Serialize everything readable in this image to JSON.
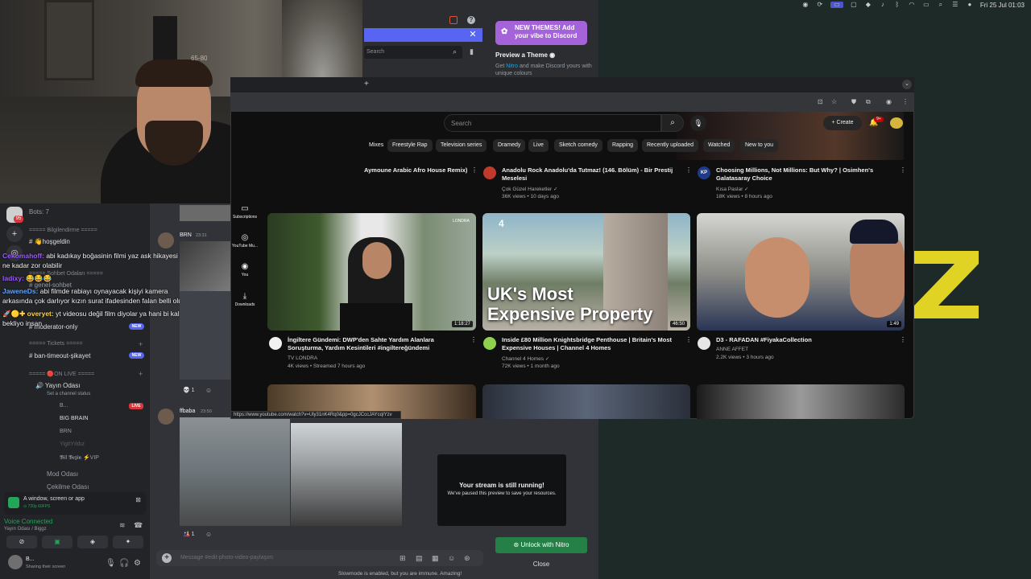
{
  "menubar": {
    "datetime": "Fri 25 Jul  01:03",
    "icons": [
      "control-icon",
      "refresh-icon",
      "screen-share-icon",
      "display-icon",
      "wifi-icon",
      "volume-icon",
      "bluetooth-icon",
      "battery-icon",
      "control-center-icon",
      "siri-icon"
    ]
  },
  "discord": {
    "popout": {
      "search_placeholder": "Search",
      "theme_badge": "NEW THEMES! Add your vibe to Discord",
      "preview_theme": "Preview a Theme",
      "nitro_prefix": "Get ",
      "nitro_link": "Nitro",
      "nitro_suffix": " and make Discord yours with unique colours"
    },
    "server": {
      "avatar_badge": "95",
      "bots": "Bots: 7",
      "channels": [
        {
          "label": "===== Bilgilendirme =====",
          "type": "category"
        },
        {
          "label": "#  👋hoşgeldin",
          "type": "text"
        },
        {
          "label": "===== Sohbet Odaları =====",
          "type": "category"
        },
        {
          "label": "#  genel-sohbet",
          "type": "text"
        },
        {
          "label": "#  moderator-only",
          "type": "text",
          "badge": "NEW"
        },
        {
          "label": "===== Tickets =====",
          "type": "category"
        },
        {
          "label": "#  ban-timeout-şikayet",
          "type": "text",
          "badge": "NEW"
        },
        {
          "label": "===== 🔴ON LIVE =====",
          "type": "category"
        },
        {
          "label": "Yayın Odası",
          "type": "voice",
          "sub": "Set a channel status"
        }
      ],
      "voice_users": [
        {
          "name": "B...",
          "live": "LIVE"
        },
        {
          "name": "BIG BRAIN"
        },
        {
          "name": "BRN"
        },
        {
          "name": "YigitYıldız"
        },
        {
          "name": "𝕭𝖎𝖑 𝕭𝖊𝖟𝖎𝖓 ⚡VIP"
        }
      ],
      "more_channels": [
        "Mod Odası",
        "Çekilme Odası"
      ]
    },
    "overlay_chat": [
      {
        "name": "Cekomahoff:",
        "text": " abi kadıkay boğasinin filmi yaz ask hikayesi değil",
        "color": "#9b59ff"
      },
      {
        "name": "",
        "text": "ne kadar zor olabilir",
        "color": "#ffffff"
      },
      {
        "name": "ladixy:",
        "text": " 😂😂😂",
        "color": "#9b59ff"
      },
      {
        "name": "JaweneDs:",
        "text": " abi filmde rabiayı oynayacak kişiyi kamera",
        "color": "#5fa4ff"
      },
      {
        "name": "",
        "text": "arkasında çok darlıyor kızın surat ifadesinden falan belli oluyor",
        "color": "#ffffff"
      },
      {
        "name": "🚀🟡✚ overyet:",
        "text": " yt videosu değil film diyolar ya hani bi kalite",
        "color": "#ffd24a"
      },
      {
        "name": "",
        "text": "bekliyo insan",
        "color": "#ffffff"
      }
    ],
    "voice_panel": {
      "title": "A window, screen or app",
      "sub": "⊙ 720p 60FPS",
      "status": "Voice Connected",
      "channel": "Yayın Odası / Biggz"
    },
    "user": {
      "name": "B...",
      "status": "Sharing their screen"
    },
    "chat": {
      "msg1_name": "BRN",
      "msg1_time": "23:31",
      "reaction1": "1",
      "msg2_name": "ffbaba",
      "msg2_time": "23:50",
      "reaction2": "1",
      "composer_placeholder": "Message #edit-photo-video-paylaşım",
      "slowmode": "Slowmode is enabled, but you are immune. Amazing!"
    },
    "stream_card": {
      "title": "Your stream is still running!",
      "sub": "We've paused this preview to save your resources."
    },
    "unlock_label": "Unlock with Nitro",
    "close_label": "Close"
  },
  "youtube": {
    "search_placeholder": "Search",
    "create_label": "Create",
    "notif_count": "9+",
    "chips": [
      "Mixes",
      "Freestyle Rap",
      "Television series",
      "Dramedy",
      "Live",
      "Sketch comedy",
      "Rapping",
      "Recently uploaded",
      "Watched",
      "New to you"
    ],
    "guide": [
      {
        "icon": "subscriptions-icon",
        "label": "Subscriptions"
      },
      {
        "icon": "youtube-music-icon",
        "label": "YouTube Mu..."
      },
      {
        "icon": "you-icon",
        "label": "You"
      },
      {
        "icon": "downloads-icon",
        "label": "Downloads"
      }
    ],
    "top_row": [
      {
        "title": "Aymoune Arabic Afro House Remix)",
        "channel": "",
        "meta": ""
      },
      {
        "title": "Anadolu Rock Anadolu'da Tutmaz! (146. Bölüm) - Bir Prestij Meselesi",
        "channel": "Çok Güzel Hareketler ✓",
        "meta": "36K views • 10 days ago"
      },
      {
        "title": "Choosing Millions, Not Millions: But Why? | Osimhen's Galatasaray Choice",
        "channel": "Kısa Paslar ✓",
        "meta": "18K views • 8 hours ago",
        "avatar_text": "KP"
      }
    ],
    "videos": [
      {
        "title": "İngiltere Gündemi: DWP'den Sahte Yardım Alanlara Soruşturma, Yardım Kesintileri #ingiltereğündemi",
        "channel": "TV LONDRA",
        "meta": "4K views • Streamed 7 hours ago",
        "duration": "1:18:27",
        "logo": "LONDRA"
      },
      {
        "title": "Inside £80 Million Knightsbridge Penthouse | Britain's Most Expensive Houses | Channel 4 Homes",
        "channel": "Channel 4 Homes ✓",
        "meta": "72K views • 1 month ago",
        "duration": "46:50",
        "overlay": "UK's Most\nExpensive Property",
        "logo": "4"
      },
      {
        "title": "D3 - RAFADAN #FiyakaCollection",
        "channel": "ANNE AFFET",
        "meta": "2.2K views • 3 hours ago",
        "duration": "1:49"
      }
    ],
    "url_tooltip": "https://www.youtube.com/watch?v=Uly31nK4Rq0&pp=0gcJCccJAYcqIYzv"
  }
}
